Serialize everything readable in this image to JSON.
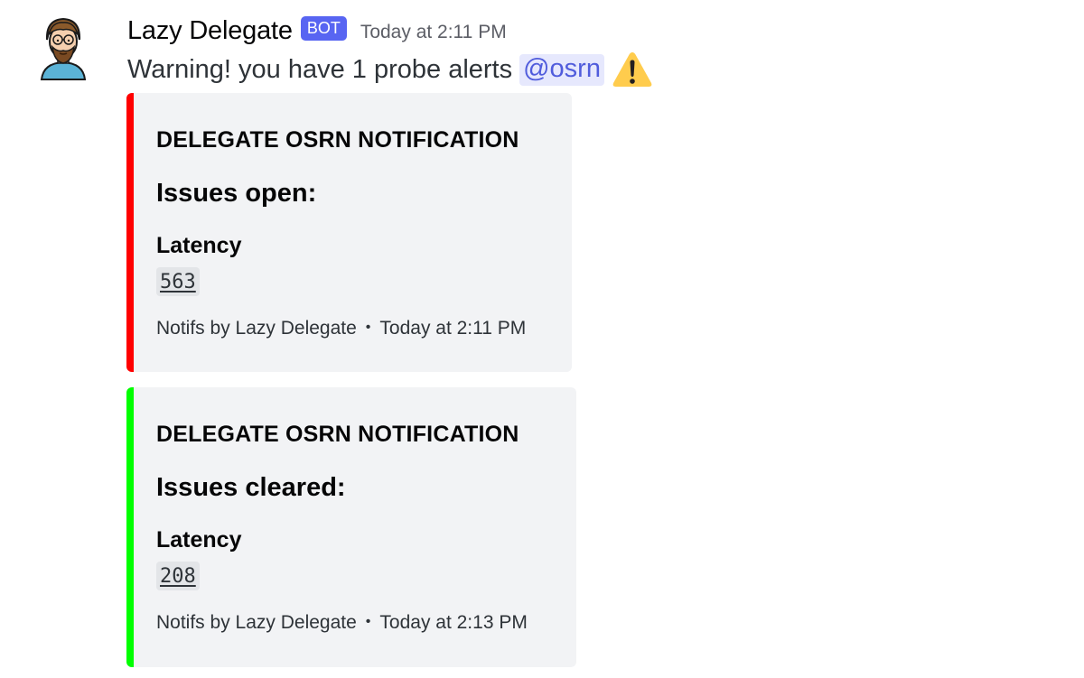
{
  "message": {
    "username": "Lazy Delegate",
    "bot_tag": "BOT",
    "timestamp": "Today at 2:11 PM",
    "content_text": "Warning! you have 1 probe alerts",
    "mention": "@osrn",
    "emoji": "warning-emoji"
  },
  "embeds": [
    {
      "accent_color": "#ff0000",
      "title": "DELEGATE OSRN NOTIFICATION",
      "description": "Issues open:",
      "field_name": "Latency",
      "field_value": "563",
      "footer_text": "Notifs by Lazy Delegate",
      "footer_separator": "•",
      "footer_timestamp": "Today at 2:11 PM"
    },
    {
      "accent_color": "#00ff00",
      "title": "DELEGATE OSRN NOTIFICATION",
      "description": "Issues cleared:",
      "field_name": "Latency",
      "field_value": "208",
      "footer_text": "Notifs by Lazy Delegate",
      "footer_separator": "•",
      "footer_timestamp": "Today at 2:13 PM"
    }
  ],
  "colors": {
    "brand_blurple": "#5865f2",
    "mention_bg": "#e6e8fd",
    "mention_fg": "#505cdc",
    "embed_bg": "#f2f3f5"
  }
}
